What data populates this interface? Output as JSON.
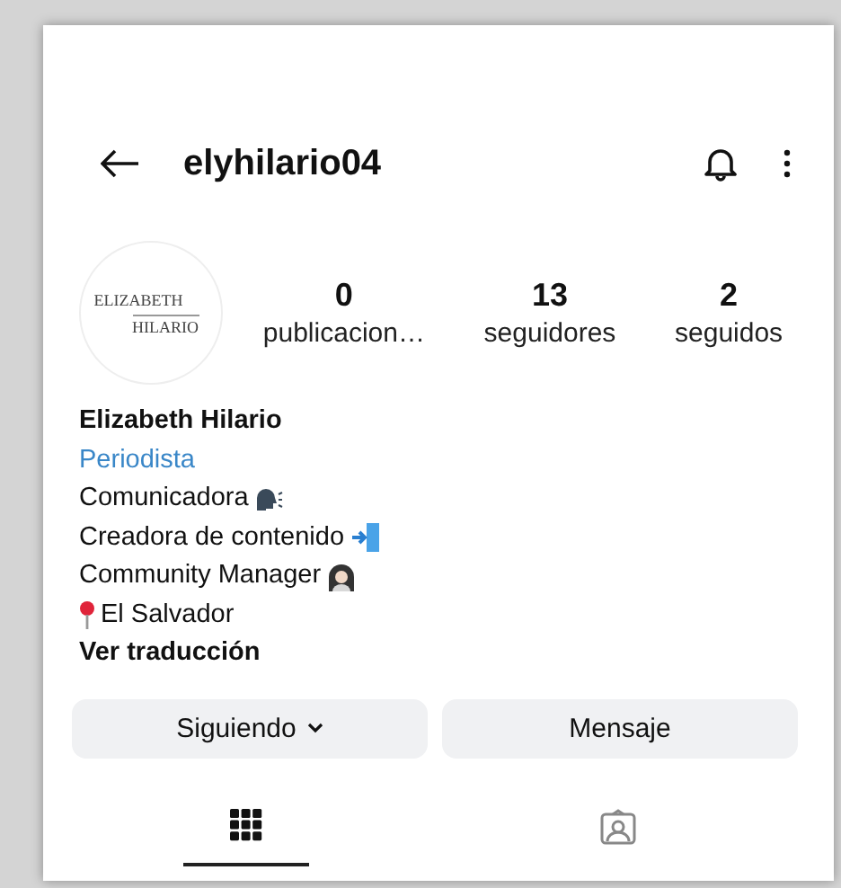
{
  "header": {
    "username": "elyhilario04"
  },
  "avatar": {
    "logo_top": "ELIZABETH",
    "logo_bottom": "HILARIO"
  },
  "stats": [
    {
      "count": "0",
      "label": "publicacion…"
    },
    {
      "count": "13",
      "label": "seguidores"
    },
    {
      "count": "2",
      "label": "seguidos"
    }
  ],
  "bio": {
    "name": "Elizabeth Hilario",
    "category": "Periodista",
    "lines": [
      {
        "text": "Comunicadora",
        "kind": "speaking"
      },
      {
        "text": "Creadora de contenido",
        "kind": "enter"
      },
      {
        "text": "Community Manager",
        "kind": "person"
      },
      {
        "text": "El Salvador",
        "kind": "pin"
      }
    ],
    "translate": "Ver traducción"
  },
  "buttons": [
    {
      "label": "Siguiendo",
      "dropdown": true
    },
    {
      "label": "Mensaje",
      "dropdown": false
    }
  ],
  "tabs": [
    {
      "kind": "grid",
      "selected": true
    },
    {
      "kind": "tagged",
      "selected": false
    }
  ]
}
